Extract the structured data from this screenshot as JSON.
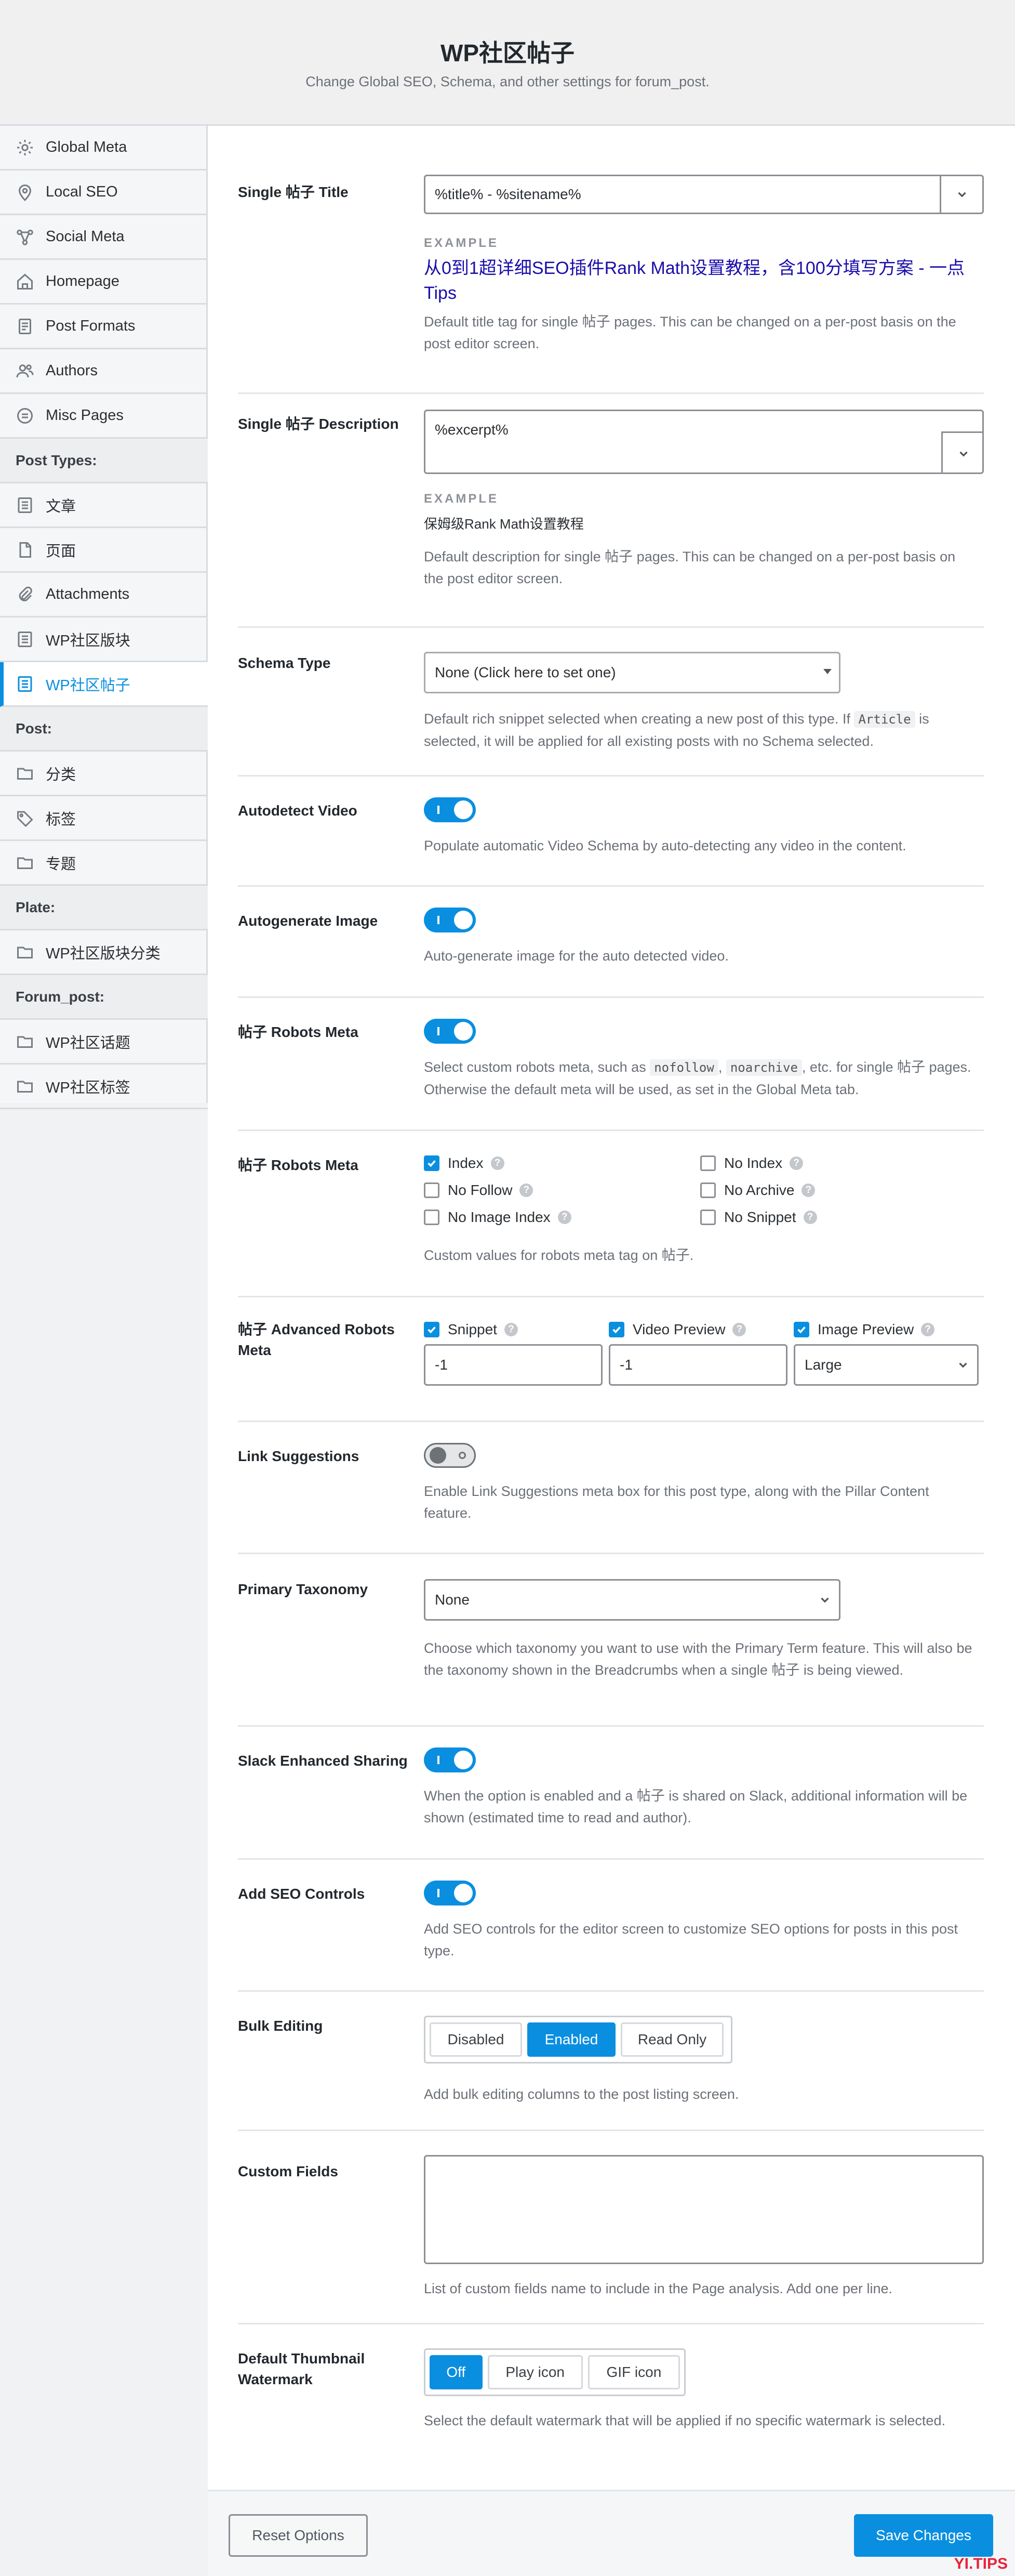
{
  "header": {
    "title": "WP社区帖子",
    "subtitle": "Change Global SEO, Schema, and other settings for forum_post."
  },
  "sidebar": {
    "items": [
      {
        "label": "Global Meta",
        "icon": "gear-icon"
      },
      {
        "label": "Local SEO",
        "icon": "map-pin-icon"
      },
      {
        "label": "Social Meta",
        "icon": "share-icon"
      },
      {
        "label": "Homepage",
        "icon": "home-icon"
      },
      {
        "label": "Post Formats",
        "icon": "document-icon"
      },
      {
        "label": "Authors",
        "icon": "users-icon"
      },
      {
        "label": "Misc Pages",
        "icon": "list-icon"
      }
    ],
    "group_post_types": "Post Types:",
    "post_types": [
      {
        "label": "文章",
        "icon": "post-icon"
      },
      {
        "label": "页面",
        "icon": "page-icon"
      },
      {
        "label": "Attachments",
        "icon": "paperclip-icon"
      },
      {
        "label": "WP社区版块",
        "icon": "post-icon"
      },
      {
        "label": "WP社区帖子",
        "icon": "post-icon",
        "active": true
      }
    ],
    "group_post": "Post:",
    "post_tax": [
      {
        "label": "分类",
        "icon": "folder-icon"
      },
      {
        "label": "标签",
        "icon": "tag-icon"
      },
      {
        "label": "专题",
        "icon": "folder-icon"
      }
    ],
    "group_plate": "Plate:",
    "plate_tax": [
      {
        "label": "WP社区版块分类",
        "icon": "folder-icon"
      }
    ],
    "group_forum_post": "Forum_post:",
    "forum_post_tax": [
      {
        "label": "WP社区话题",
        "icon": "folder-icon"
      },
      {
        "label": "WP社区标签",
        "icon": "folder-icon"
      }
    ]
  },
  "settings": {
    "title": {
      "label": "Single 帖子 Title",
      "value": "%title% - %sitename%",
      "example_label": "EXAMPLE",
      "example_value": "从0到1超详细SEO插件Rank Math设置教程，含100分填写方案 - 一点Tips",
      "desc": "Default title tag for single 帖子 pages. This can be changed on a per-post basis on the post editor screen."
    },
    "description": {
      "label": "Single 帖子 Description",
      "value": "%excerpt%",
      "example_label": "EXAMPLE",
      "example_value": "保姆级Rank Math设置教程",
      "desc": "Default description for single 帖子 pages. This can be changed on a per-post basis on the post editor screen."
    },
    "schema": {
      "label": "Schema Type",
      "value": "None (Click here to set one)",
      "desc_pre": "Default rich snippet selected when creating a new post of this type. If",
      "desc_code": "Article",
      "desc_post": "is selected, it will be applied for all existing posts with no Schema selected."
    },
    "autodetect_video": {
      "label": "Autodetect Video",
      "desc": "Populate automatic Video Schema by auto-detecting any video in the content."
    },
    "autogenerate_image": {
      "label": "Autogenerate Image",
      "desc": "Auto-generate image for the auto detected video."
    },
    "robots_meta_toggle": {
      "label": "帖子 Robots Meta",
      "desc_pre": "Select custom robots meta, such as",
      "code1": "nofollow",
      "sep": ",",
      "code2": "noarchive",
      "desc_post": ", etc. for single 帖子 pages. Otherwise the default meta will be used, as set in the Global Meta tab."
    },
    "robots_meta": {
      "label": "帖子 Robots Meta",
      "options": [
        {
          "label": "Index",
          "checked": true
        },
        {
          "label": "No Index",
          "checked": false
        },
        {
          "label": "No Follow",
          "checked": false
        },
        {
          "label": "No Archive",
          "checked": false
        },
        {
          "label": "No Image Index",
          "checked": false
        },
        {
          "label": "No Snippet",
          "checked": false
        }
      ],
      "desc": "Custom values for robots meta tag on 帖子."
    },
    "advanced_robots": {
      "label": "帖子 Advanced Robots Meta",
      "snippet": "Snippet",
      "video_preview": "Video Preview",
      "image_preview": "Image Preview",
      "snippet_value": "-1",
      "video_value": "-1",
      "image_value": "Large"
    },
    "link_suggestions": {
      "label": "Link Suggestions",
      "desc": "Enable Link Suggestions meta box for this post type, along with the Pillar Content feature."
    },
    "primary_taxonomy": {
      "label": "Primary Taxonomy",
      "value": "None",
      "desc": "Choose which taxonomy you want to use with the Primary Term feature. This will also be the taxonomy shown in the Breadcrumbs when a single 帖子 is being viewed."
    },
    "slack": {
      "label": "Slack Enhanced Sharing",
      "desc": "When the option is enabled and a 帖子 is shared on Slack, additional information will be shown (estimated time to read and author)."
    },
    "seo_controls": {
      "label": "Add SEO Controls",
      "desc": "Add SEO controls for the editor screen to customize SEO options for posts in this post type."
    },
    "bulk_editing": {
      "label": "Bulk Editing",
      "options": [
        "Disabled",
        "Enabled",
        "Read Only"
      ],
      "selected": "Enabled",
      "desc": "Add bulk editing columns to the post listing screen."
    },
    "custom_fields": {
      "label": "Custom Fields",
      "desc": "List of custom fields name to include in the Page analysis. Add one per line."
    },
    "thumbnail_watermark": {
      "label": "Default Thumbnail Watermark",
      "options": [
        "Off",
        "Play icon",
        "GIF icon"
      ],
      "selected": "Off",
      "desc": "Select the default watermark that will be applied if no specific watermark is selected."
    }
  },
  "footer": {
    "reset": "Reset Options",
    "save": "Save Changes"
  },
  "watermark": "YI.TIPS",
  "colors": {
    "accent": "#0a8fe0",
    "link": "#1a0dab"
  }
}
